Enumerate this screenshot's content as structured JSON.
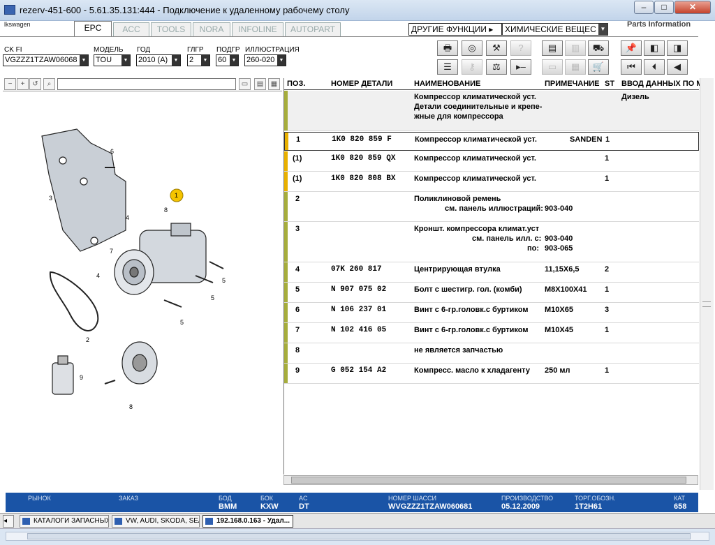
{
  "window": {
    "title": "rezerv-451-600 - 5.61.35.131:444 - Подключение к удаленному рабочему столу",
    "minimize": "–",
    "maximize": "□",
    "close": "✕"
  },
  "brand": "lkswagen",
  "tabs": [
    "EPC",
    "ACC",
    "TOOLS",
    "NORA",
    "INFOLINE",
    "AUTOPART"
  ],
  "other_functions": "ДРУГИЕ ФУНКЦИИ ▸",
  "chem_dropdown": "ХИМИЧЕСКИЕ ВЕЩЕС",
  "parts_info": "Parts Information",
  "filters": {
    "ck_label": "CK FI",
    "ck_value": "VGZZZ1TZAW06068",
    "model_label": "МОДЕЛЬ",
    "model_value": "TOU",
    "year_label": "ГОД",
    "year_value": "2010 (A)",
    "group_label": "ГЛГР",
    "group_value": "2",
    "subgroup_label": "ПОДГР",
    "subgroup_value": "60",
    "illustration_label": "ИЛЛЮСТРАЦИЯ",
    "illustration_value": "260-020"
  },
  "table": {
    "headers": {
      "pos": "ПОЗ.",
      "part": "НОМЕР ДЕТАЛИ",
      "name": "НАИМЕНОВАНИЕ",
      "note": "ПРИМЕЧАНИЕ",
      "st": "ST",
      "data": "ВВОД ДАННЫХ ПО М"
    },
    "intro": {
      "line1": "Компрессор климатической уст.",
      "line2": "Детали соединительные и крепе-",
      "line3": "жные для компрессора",
      "data": "Дизель"
    },
    "rows": [
      {
        "pos": "1",
        "part": "1K0  820  859  F",
        "name": "Компрессор климатической уст.",
        "note": "SANDEN",
        "st": "1"
      },
      {
        "pos": "(1)",
        "part": "1K0  820  859  QX",
        "name": "Компрессор климатической уст.",
        "note": "",
        "st": "1"
      },
      {
        "pos": "(1)",
        "part": "1K0  820  808  BX",
        "name": "Компрессор климатической уст.",
        "note": "",
        "st": "1"
      },
      {
        "pos": "2",
        "part": "",
        "name": "Поликлиновой ремень",
        "sub1_label": "см. панель иллюстраций:",
        "sub1_value": "903-040",
        "note": "",
        "st": ""
      },
      {
        "pos": "3",
        "part": "",
        "name": "Кроншт. компрессора климат.уст",
        "sub1_label": "см. панель илл. с:",
        "sub1_value": "903-040",
        "sub2_label": "по:",
        "sub2_value": "903-065",
        "note": "",
        "st": ""
      },
      {
        "pos": "4",
        "part": "07K  260  817",
        "name": "Центрирующая втулка",
        "note": "11,15X6,5",
        "st": "2"
      },
      {
        "pos": "5",
        "part": "N     907  075  02",
        "name": "Болт с шестигр. гол. (комби)",
        "note": "M8X100X41",
        "st": "1"
      },
      {
        "pos": "6",
        "part": "N     106  237  01",
        "name": "Винт с 6-гр.головк.с буртиком",
        "note": "M10X65",
        "st": "3"
      },
      {
        "pos": "7",
        "part": "N     102  416  05",
        "name": "Винт с 6-гр.головк.с буртиком",
        "note": "M10X45",
        "st": "1"
      },
      {
        "pos": "8",
        "part": "",
        "name": "не является запчастью",
        "note": "",
        "st": ""
      },
      {
        "pos": "9",
        "part": "G     052  154  A2",
        "name": "Компресс. масло к хладагенту",
        "note": "250 мл",
        "st": "1"
      }
    ]
  },
  "diagram_labels": {
    "l1": "1",
    "l2": "2",
    "l3": "3",
    "l4a": "4",
    "l4b": "4",
    "l5a": "5",
    "l5b": "5",
    "l5c": "5",
    "l6": "6",
    "l7": "7",
    "l8a": "8",
    "l8b": "8",
    "l9": "9"
  },
  "status": {
    "market_label": "РЫНОК",
    "order_label": "ЗАКАЗ",
    "bod_label": "БОД",
    "bod_value": "BMM",
    "bok_label": "БОК",
    "bok_value": "KXW",
    "ac_label": "AC",
    "ac_value": "DT",
    "chassis_label": "НОМЕР ШАССИ",
    "chassis_value": "WVGZZZ1TZAW060681",
    "production_label": "ПРОИЗВОДСТВО",
    "production_value": "05.12.2009",
    "trade_label": "ТОРГ.ОБОЗН.",
    "trade_value": "1T2H61",
    "cat_label": "КАТ",
    "cat_value": "658"
  },
  "taskbar": {
    "item1": "КАТАЛОГИ ЗАПАСНЫХ ...",
    "item2": "VW, AUDI, SKODA, SEAT",
    "item3": "192.168.0.163 - Удал..."
  },
  "colors": {
    "accent_blue": "#1a54a6",
    "row_gold": "#e8b000",
    "row_green": "#a6ad3c",
    "badge_yellow": "#f5c400"
  }
}
